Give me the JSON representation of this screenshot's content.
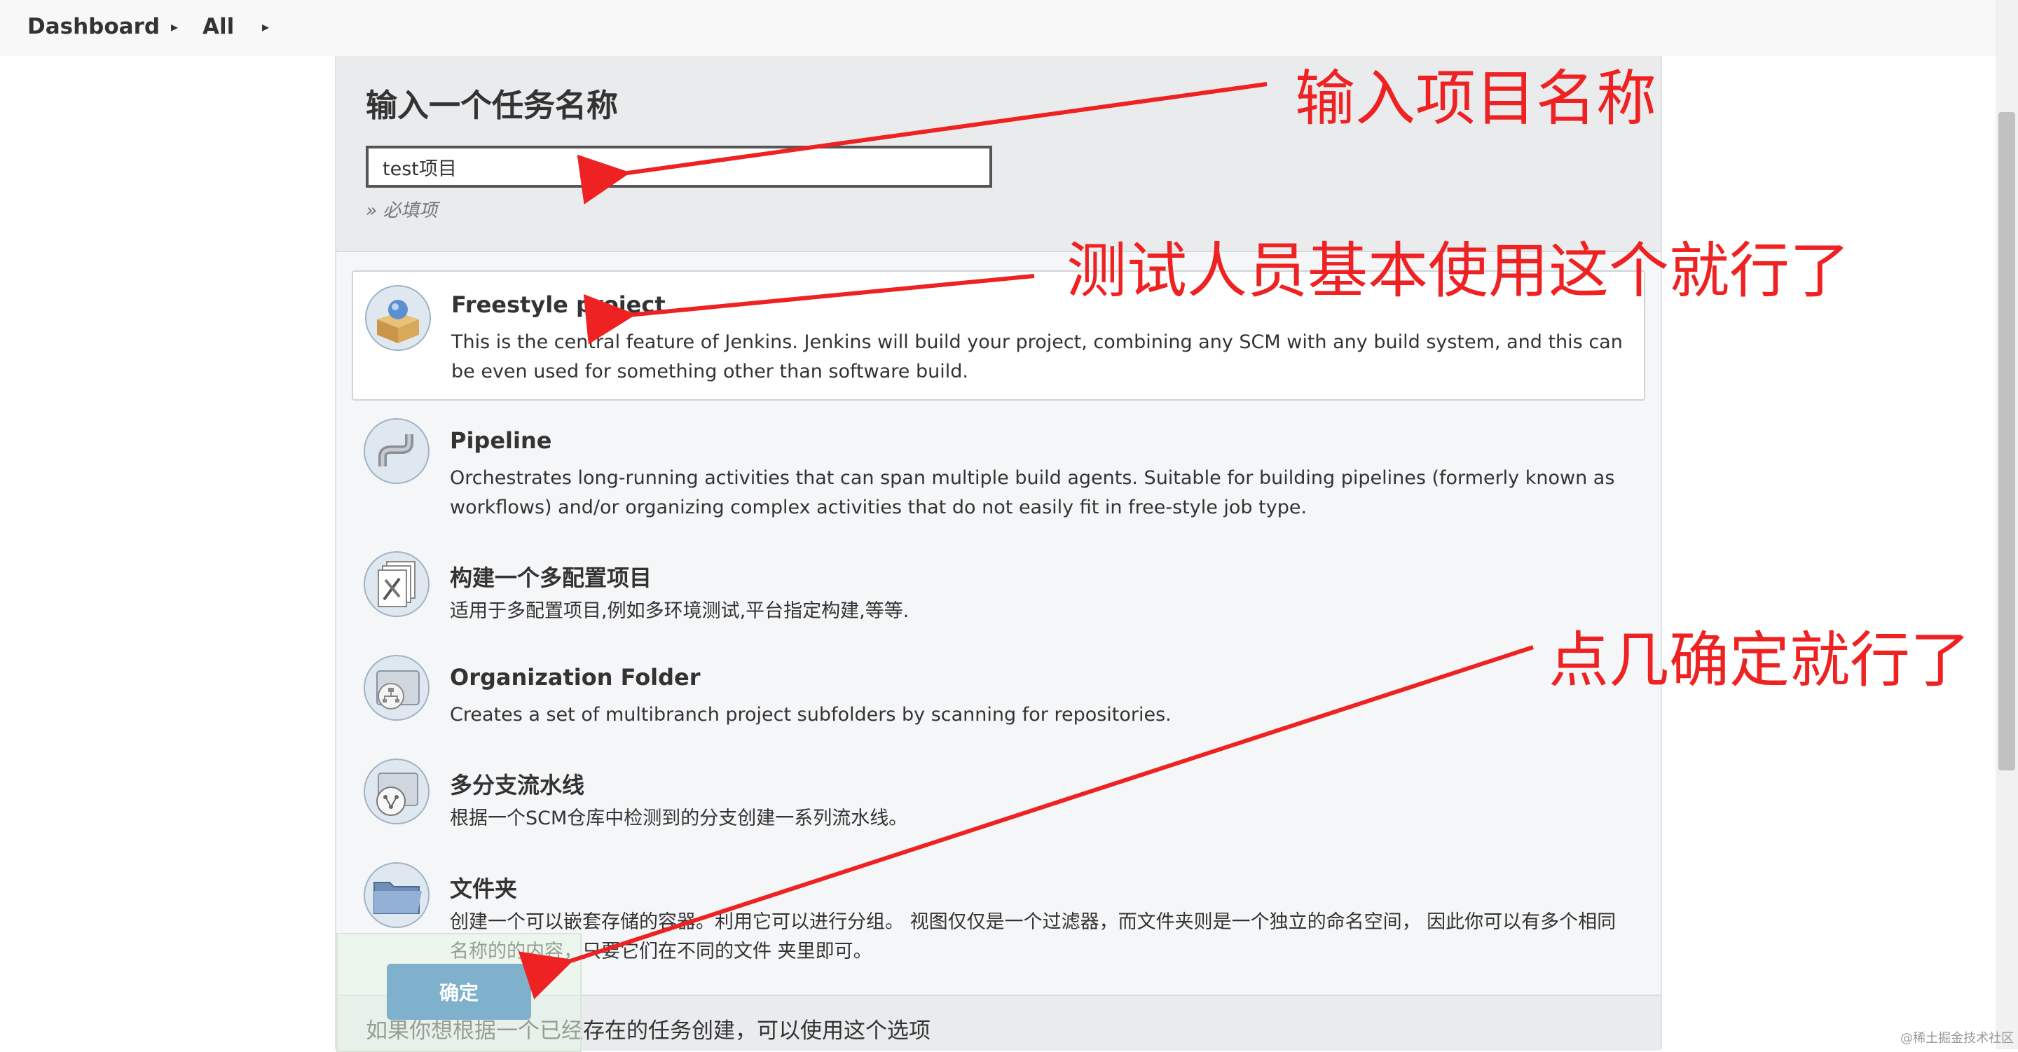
{
  "breadcrumb": {
    "items": [
      "Dashboard",
      "All"
    ]
  },
  "form": {
    "title": "输入一个任务名称",
    "name_value": "test项目",
    "required_hint": "» 必填项"
  },
  "items": [
    {
      "name": "Freestyle project",
      "desc": "This is the central feature of Jenkins. Jenkins will build your project, combining any SCM with any build system, and this can be even used for something other than software build.",
      "icon": "freestyle-box-icon"
    },
    {
      "name": "Pipeline",
      "desc": "Orchestrates long-running activities that can span multiple build agents. Suitable for building pipelines (formerly known as workflows) and/or organizing complex activities that do not easily fit in free-style job type.",
      "icon": "pipeline-icon"
    },
    {
      "name": "构建一个多配置项目",
      "desc": "适用于多配置项目,例如多环境测试,平台指定构建,等等.",
      "icon": "multi-config-icon"
    },
    {
      "name": "Organization Folder",
      "desc": "Creates a set of multibranch project subfolders by scanning for repositories.",
      "icon": "organization-folder-icon"
    },
    {
      "name": "多分支流水线",
      "desc": "根据一个SCM仓库中检测到的分支创建一系列流水线。",
      "icon": "multibranch-icon"
    },
    {
      "name": "文件夹",
      "desc": "创建一个可以嵌套存储的容器。利用它可以进行分组。 视图仅仅是一个过滤器，而文件夹则是一个独立的命名空间， 因此你可以有多个相同名称的的内容，只要它们在不同的文件 夹里即可。",
      "icon": "folder-icon"
    }
  ],
  "ok_label": "确定",
  "copy_hint": "如果你想根据一个已经存在的任务创建，可以使用这个选项",
  "annotations": {
    "a1": "输入项目名称",
    "a2": "测试人员基本使用这个就行了",
    "a3": "点几确定就行了"
  },
  "watermark": "@稀土掘金技术社区",
  "colors": {
    "annotation": "#ee2222",
    "ok_button": "#7fb0cc"
  }
}
